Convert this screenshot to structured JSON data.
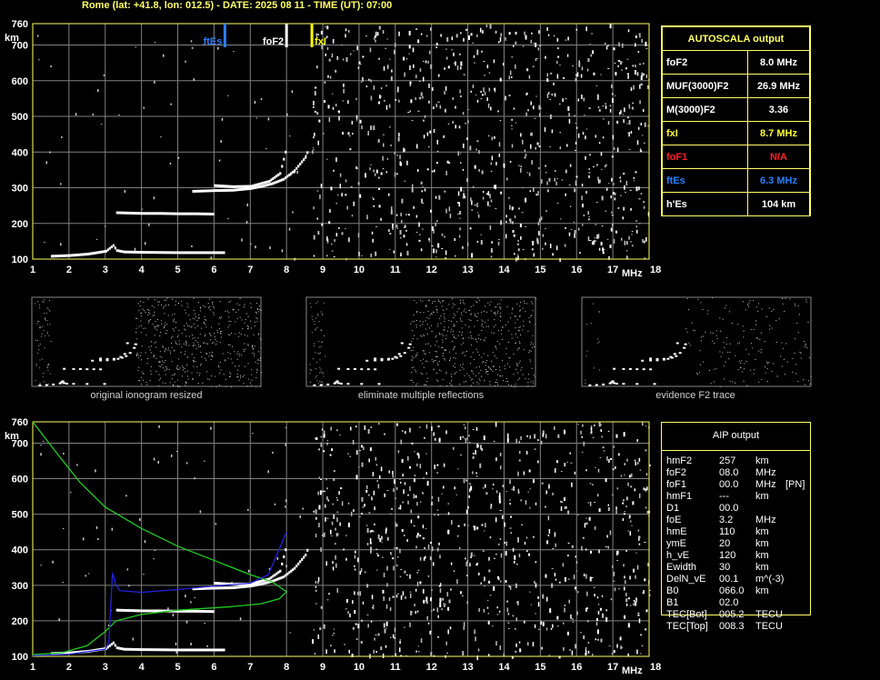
{
  "header": "Rome (lat: +41.8, lon: 012.5) - DATE: 2025 08 11 - TIME (UT): 07:00",
  "axes": {
    "y_unit": "km",
    "x_unit": "MHz",
    "y_ticks": [
      "100",
      "200",
      "300",
      "400",
      "500",
      "600",
      "700",
      "760"
    ],
    "x_ticks": [
      "1",
      "2",
      "3",
      "4",
      "5",
      "6",
      "7",
      "8",
      "9",
      "10",
      "11",
      "12",
      "13",
      "14",
      "15",
      "16",
      "17",
      "18"
    ]
  },
  "markers": [
    {
      "label": "ftEs",
      "freq": 6.3,
      "color": "#2a7fff"
    },
    {
      "label": "foF2",
      "freq": 8.0,
      "color": "#ffffff"
    },
    {
      "label": "fxI",
      "freq": 8.7,
      "color": "#ffff00"
    }
  ],
  "colors": {
    "frame": "#ffff66",
    "grid": "#808080",
    "ftEs": "#2a7fff",
    "foF1": "#ff2020",
    "fxI": "#ffff33",
    "profile": "#22cc22",
    "trace": "#2222dd"
  },
  "autoscala": {
    "title": "AUTOSCALA output",
    "rows": [
      {
        "label": "foF2",
        "value": "8.0 MHz",
        "color": "#ffffff"
      },
      {
        "label": "MUF(3000)F2",
        "value": "26.9 MHz",
        "color": "#ffffff"
      },
      {
        "label": "M(3000)F2",
        "value": "3.36",
        "color": "#ffffff"
      },
      {
        "label": "fxI",
        "value": "8.7 MHz",
        "color": "#ffff33"
      },
      {
        "label": "foF1",
        "value": "N/A",
        "color": "#ff2020"
      },
      {
        "label": "ftEs",
        "value": "6.3 MHz",
        "color": "#2a7fff"
      },
      {
        "label": "h'Es",
        "value": "104     km",
        "color": "#ffffff"
      }
    ]
  },
  "thumbnails": [
    {
      "caption": "original ionogram resized"
    },
    {
      "caption": "eliminate multiple reflections"
    },
    {
      "caption": "evidence F2 trace"
    }
  ],
  "aip": {
    "title": "AIP output",
    "rows": [
      {
        "name": "hmF2",
        "value": "257",
        "unit": "km",
        "extra": ""
      },
      {
        "name": "foF2",
        "value": "08.0",
        "unit": "MHz",
        "extra": ""
      },
      {
        "name": "foF1",
        "value": "00.0",
        "unit": "MHz",
        "extra": "[PN]"
      },
      {
        "name": "hmF1",
        "value": "---",
        "unit": "km",
        "extra": ""
      },
      {
        "name": "D1",
        "value": "00.0",
        "unit": "",
        "extra": ""
      },
      {
        "name": "foE",
        "value": "3.2",
        "unit": "MHz",
        "extra": ""
      },
      {
        "name": "hmE",
        "value": "110",
        "unit": "km",
        "extra": ""
      },
      {
        "name": "ymE",
        "value": "20",
        "unit": "km",
        "extra": ""
      },
      {
        "name": "h_vE",
        "value": "120",
        "unit": "km",
        "extra": ""
      },
      {
        "name": "Ewidth",
        "value": "30",
        "unit": "km",
        "extra": ""
      },
      {
        "name": "DelN_vE",
        "value": "00.1",
        "unit": "m^(-3)",
        "extra": ""
      },
      {
        "name": "B0",
        "value": "066.0",
        "unit": "km",
        "extra": ""
      },
      {
        "name": "B1",
        "value": "02.0",
        "unit": "",
        "extra": ""
      },
      {
        "name": "TEC[Bot]",
        "value": "005.2",
        "unit": "TECU",
        "extra": ""
      },
      {
        "name": "TEC[Top]",
        "value": "008.3",
        "unit": "TECU",
        "extra": ""
      }
    ]
  },
  "chart_data": [
    {
      "type": "scatter",
      "name": "ionogram",
      "xlim": [
        1,
        18
      ],
      "ylim": [
        100,
        760
      ],
      "x_unit": "MHz",
      "y_unit": "km",
      "traces": [
        {
          "id": "E",
          "x": [
            1.5,
            2,
            2.5,
            3,
            3.1,
            3.2,
            3.3,
            3.5,
            4,
            5,
            6.3
          ],
          "y": [
            108,
            110,
            114,
            122,
            130,
            138,
            124,
            120,
            119,
            118,
            118
          ]
        },
        {
          "id": "Es2",
          "x": [
            3.3,
            4,
            4.5,
            5,
            5.5,
            6
          ],
          "y": [
            230,
            228,
            228,
            227,
            227,
            226
          ]
        },
        {
          "id": "F2",
          "x": [
            5.4,
            6,
            6.5,
            7,
            7.3,
            7.6,
            7.9,
            8.2,
            8.5,
            8.6
          ],
          "y": [
            290,
            292,
            293,
            298,
            304,
            312,
            324,
            348,
            385,
            412
          ]
        },
        {
          "id": "F2b",
          "x": [
            6,
            6.5,
            7,
            7.5,
            7.8,
            8.0
          ],
          "y": [
            306,
            303,
            304,
            318,
            340,
            420
          ]
        }
      ]
    },
    {
      "type": "line",
      "name": "aip-profile",
      "xlim": [
        1,
        18
      ],
      "ylim": [
        100,
        760
      ],
      "series": [
        {
          "id": "profile",
          "x": [
            1,
            1.6,
            2.3,
            3,
            4,
            5,
            6,
            7,
            7.6,
            8,
            7.8,
            7.3,
            6.5,
            5,
            4,
            3.3,
            3,
            2.5,
            1.8,
            1
          ],
          "y": [
            760,
            680,
            590,
            520,
            460,
            410,
            370,
            330,
            310,
            282,
            262,
            248,
            240,
            230,
            218,
            200,
            170,
            130,
            110,
            105
          ]
        },
        {
          "id": "trace",
          "x": [
            1,
            2,
            3,
            3.1,
            3.2,
            3.3,
            3.4,
            4,
            5,
            6,
            7,
            7.5,
            8
          ],
          "y": [
            102,
            106,
            120,
            140,
            335,
            300,
            285,
            280,
            288,
            298,
            306,
            330,
            450
          ]
        }
      ]
    }
  ]
}
